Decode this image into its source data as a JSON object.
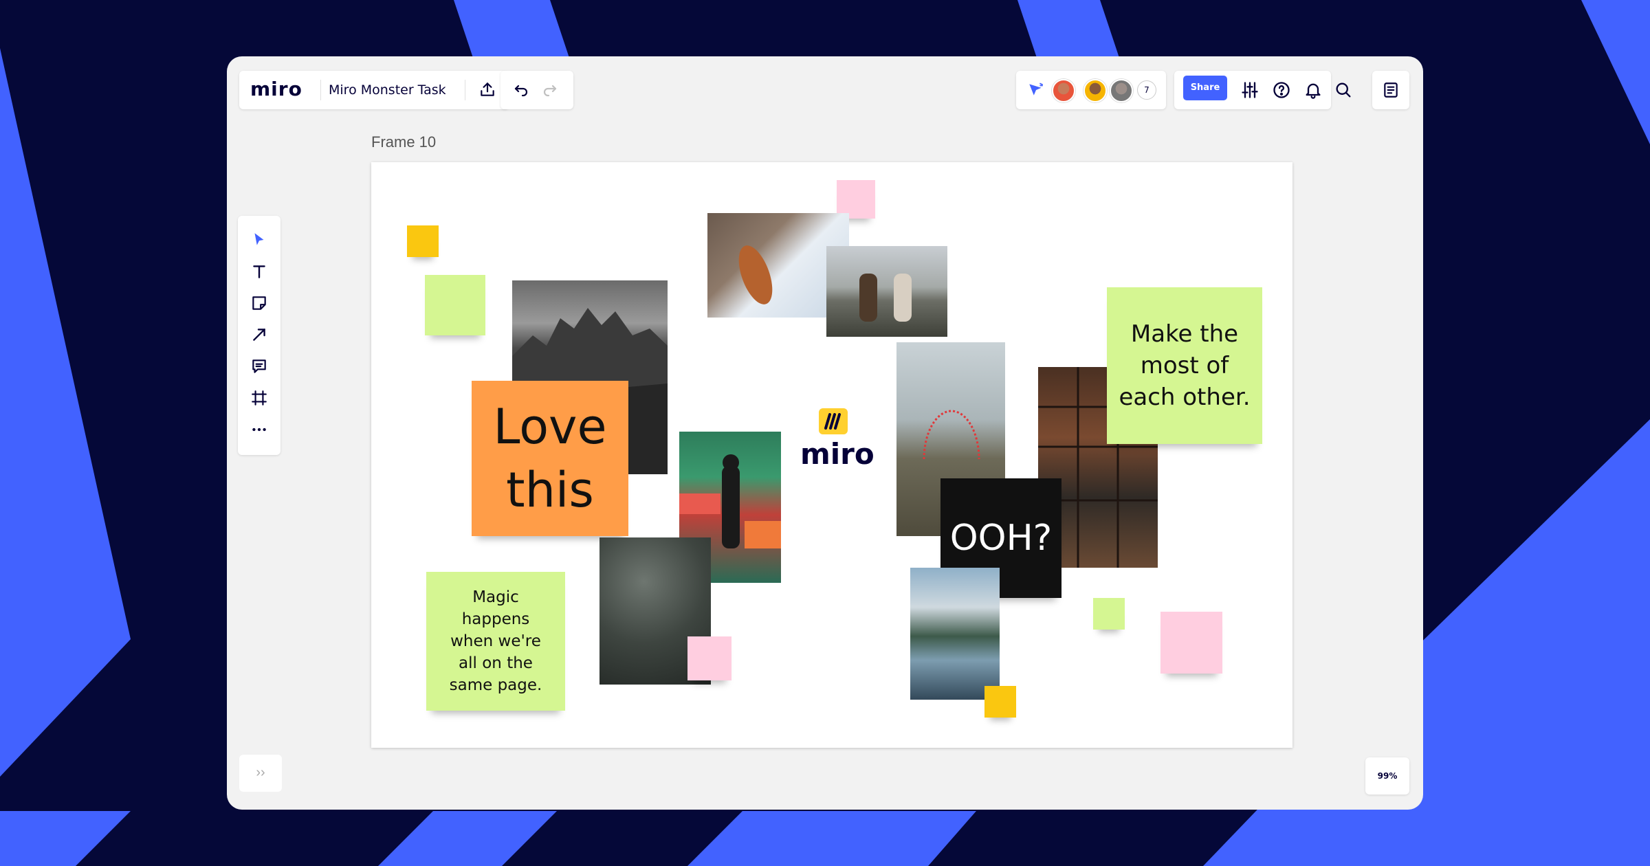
{
  "app": {
    "logo": "miro",
    "board_title": "Miro Monster Task",
    "collaborator_count": "7",
    "share_label": "Share",
    "zoom_level": "99%",
    "expand_label": "››"
  },
  "toolbar": {
    "tools": [
      "select-tool",
      "text-tool",
      "sticky-note-tool",
      "connection-line-tool",
      "comment-tool",
      "frame-tool",
      "more-tools"
    ]
  },
  "frame": {
    "label": "Frame 10"
  },
  "stickies": {
    "love": "Love this",
    "make_most": "Make the most of each other.",
    "magic": "Magic happens when we're all on the same page.",
    "ooh": "OOH?"
  },
  "center_logo": {
    "text": "miro"
  },
  "colors": {
    "accent": "#4262ff",
    "background": "#050838",
    "sticky_green": "#d5f692",
    "sticky_orange": "#ff9d48",
    "sticky_yellow": "#fac710",
    "sticky_pink": "#ffcee0",
    "sticky_black": "#111111"
  }
}
